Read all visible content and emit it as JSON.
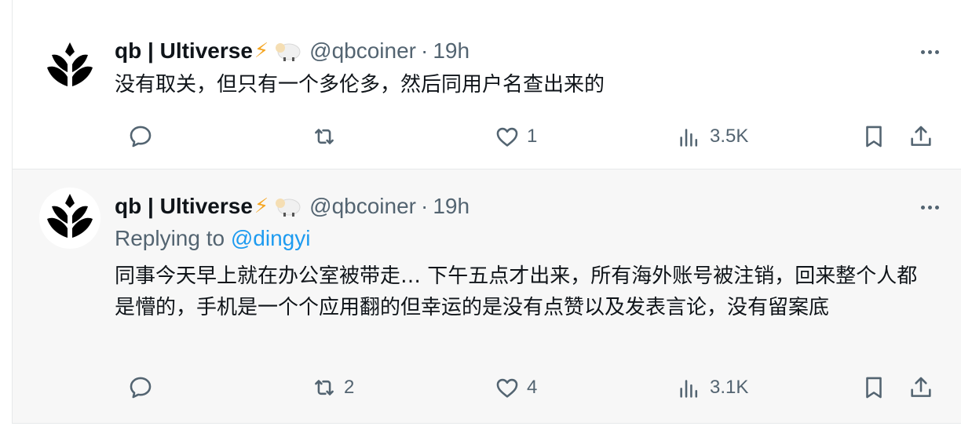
{
  "tweets": [
    {
      "author_name": "qb | Ultiverse",
      "handle": "@qbcoiner",
      "separator": "·",
      "time": "19h",
      "text": "没有取关，但只有一个多伦多，然后同用户名查出来的",
      "replies": "",
      "retweets": "",
      "likes": "1",
      "views": "3.5K"
    },
    {
      "author_name": "qb | Ultiverse",
      "handle": "@qbcoiner",
      "separator": "·",
      "time": "19h",
      "replying_prefix": "Replying to",
      "replying_to": "@dingyi",
      "text": "同事今天早上就在办公室被带走… 下午五点才出来，所有海外账号被注销，回来整个人都是懵的，手机是一个个应用翻的但幸运的是没有点赞以及发表言论，没有留案底",
      "replies": "",
      "retweets": "2",
      "likes": "4",
      "views": "3.1K"
    }
  ],
  "icons": {
    "emoji": [
      "lightning-icon",
      "sheep-icon"
    ],
    "actions": [
      "reply-icon",
      "retweet-icon",
      "like-icon",
      "views-icon",
      "bookmark-icon",
      "share-icon"
    ],
    "menu": "more-icon"
  },
  "colors": {
    "text": "#0f1419",
    "secondary": "#536471",
    "link": "#1d9bf0",
    "bolt": "#f5a623",
    "highlight_bg": "#f7f7f7"
  }
}
